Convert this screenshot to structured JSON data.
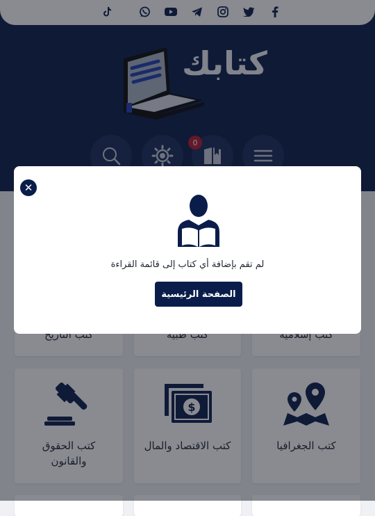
{
  "social": {
    "icons": [
      "tiktok-icon",
      "whatsapp-icon",
      "youtube-icon",
      "telegram-icon",
      "instagram-icon",
      "twitter-icon",
      "facebook-icon"
    ]
  },
  "header": {
    "logo_text": "كتابك",
    "bookmark_count": "0",
    "buttons": [
      "search-icon",
      "brightness-icon",
      "bookmark-icon",
      "menu-icon"
    ]
  },
  "categories": [
    {
      "label": "كتب التاريخ"
    },
    {
      "label": "كتب طبية"
    },
    {
      "label": "كتب إسلامية"
    },
    {
      "label": "كتب الحقوق والقانون"
    },
    {
      "label": "كتب الاقتصاد والمال"
    },
    {
      "label": "كتب الجغرافيا"
    }
  ],
  "modal": {
    "message": "لم تقم بإضافة أي كتاب إلى قائمة القراءة",
    "button_label": "الصفحة الرئيسية",
    "close_symbol": "✕"
  },
  "colors": {
    "brand": "#0a1d4a",
    "badge": "#b5182e",
    "background": "#f0f1f4"
  }
}
